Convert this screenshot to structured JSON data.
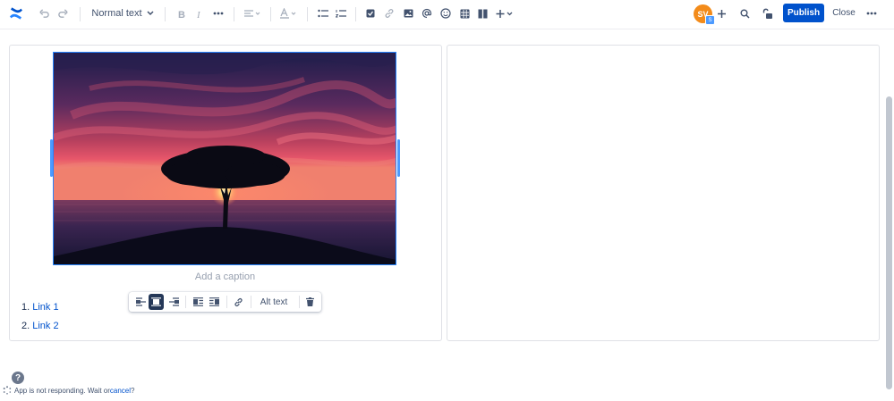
{
  "toolbar": {
    "text_style": "Normal text",
    "avatar_initials": "SV",
    "avatar_badge": "S",
    "publish_label": "Publish",
    "close_label": "Close",
    "icons": [
      "confluence-logo",
      "undo",
      "redo",
      "text-style-chevron",
      "bold",
      "italic",
      "more-formatting",
      "alignment",
      "text-color",
      "bullet-list",
      "numbered-list",
      "action-item",
      "link",
      "image",
      "mention",
      "emoji",
      "table",
      "layouts",
      "insert-more",
      "add-collaborator",
      "search",
      "restrictions",
      "more-actions"
    ]
  },
  "editor": {
    "caption_placeholder": "Add a caption",
    "list": [
      {
        "number": "1.",
        "label": "Link 1"
      },
      {
        "number": "2.",
        "label": "Link 2"
      }
    ],
    "image_toolbar": {
      "alt_text_label": "Alt text",
      "icons": [
        "align-left",
        "align-center",
        "align-right",
        "wrap-left",
        "wrap-right",
        "link",
        "delete"
      ],
      "active": "align-center"
    }
  },
  "status_bar": {
    "message": "App is not responding. Wait or ",
    "cancel_label": "cancel",
    "suffix": "?",
    "help_glyph": "?"
  },
  "colors": {
    "primary": "#0052cc",
    "avatar": "#f38b1a",
    "selection": "#2684ff"
  }
}
